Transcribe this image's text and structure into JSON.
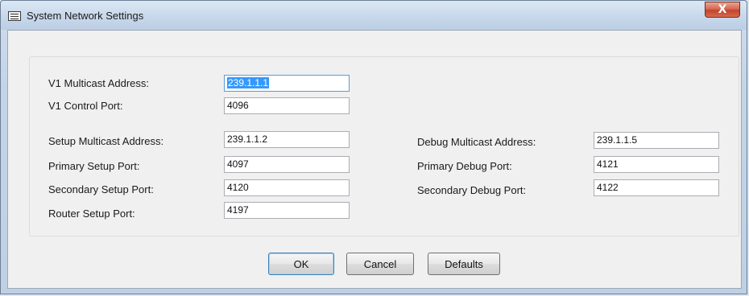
{
  "window": {
    "title": "System Network Settings",
    "close_glyph": "X"
  },
  "form": {
    "v1_multicast": {
      "label": "V1 Multicast Address:",
      "value": "239.1.1.1"
    },
    "v1_control": {
      "label": "V1 Control Port:",
      "value": "4096"
    },
    "setup_multicast": {
      "label": "Setup Multicast Address:",
      "value": "239.1.1.2"
    },
    "primary_setup": {
      "label": "Primary Setup Port:",
      "value": "4097"
    },
    "secondary_setup": {
      "label": "Secondary Setup Port:",
      "value": "4120"
    },
    "router_setup": {
      "label": "Router Setup Port:",
      "value": "4197"
    },
    "debug_multicast": {
      "label": "Debug Multicast Address:",
      "value": "239.1.1.5"
    },
    "primary_debug": {
      "label": "Primary Debug Port:",
      "value": "4121"
    },
    "secondary_debug": {
      "label": "Secondary Debug Port:",
      "value": "4122"
    }
  },
  "buttons": {
    "ok": "OK",
    "cancel": "Cancel",
    "defaults": "Defaults"
  }
}
